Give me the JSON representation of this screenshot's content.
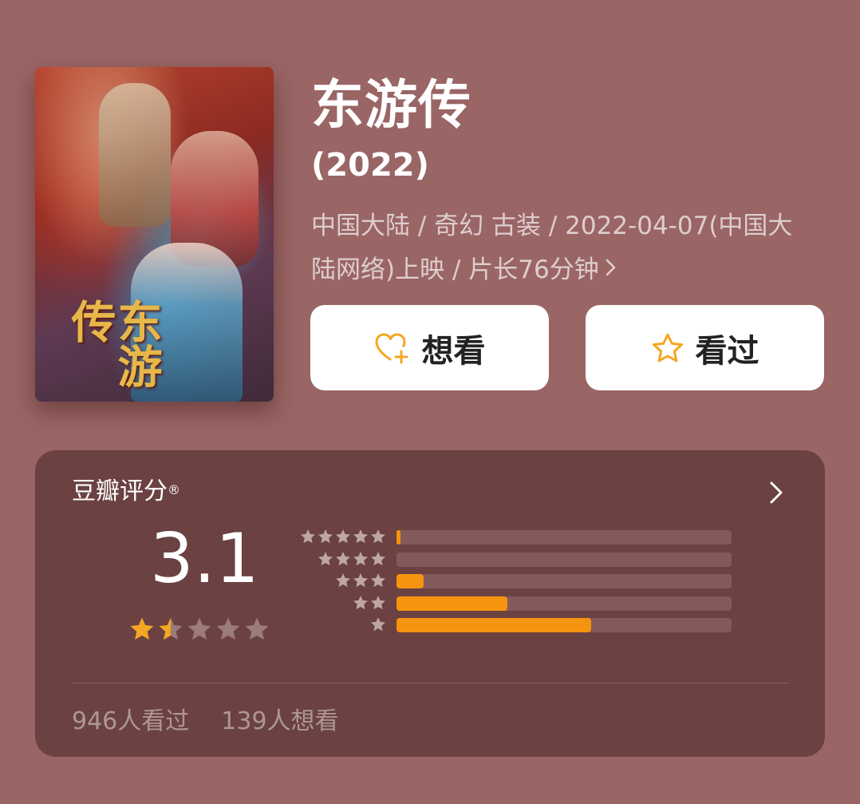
{
  "movie": {
    "title": "东游传",
    "year": "(2022)",
    "meta_line1": "中国大陆 / 奇幻 古装 / 2022-04-07(中国大",
    "meta_line2": "陆网络)上映 / 片长76分钟",
    "poster_text": "东游传"
  },
  "actions": {
    "want_label": "想看",
    "seen_label": "看过"
  },
  "rating": {
    "title": "豆瓣评分",
    "registered_mark": "®",
    "score": "3.1",
    "star_rating": 1.5,
    "distribution": [
      {
        "stars": 5,
        "percent": 1
      },
      {
        "stars": 4,
        "percent": 0
      },
      {
        "stars": 3,
        "percent": 8
      },
      {
        "stars": 2,
        "percent": 33
      },
      {
        "stars": 1,
        "percent": 58
      }
    ],
    "seen_count": "946人看过",
    "want_count": "139人想看"
  },
  "icons": {
    "want": "heart-plus-icon",
    "seen": "star-outline-icon",
    "more": "chevron-right-icon"
  },
  "colors": {
    "background": "#9a6565",
    "card": "#6b4141",
    "accent": "#f5940f",
    "star_active": "#f5a623",
    "star_inactive": "#9c7b7b"
  }
}
